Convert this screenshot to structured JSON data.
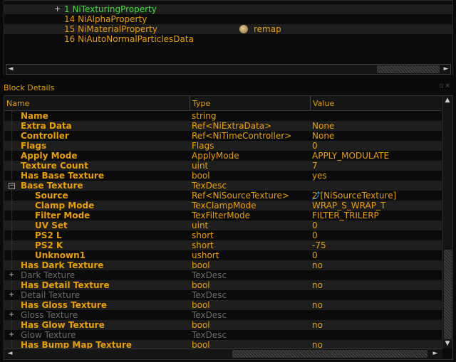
{
  "tree": {
    "rows": [
      {
        "label": "",
        "toggle": "",
        "extra": "",
        "sel": false
      },
      {
        "label": "1 NiTexturingProperty",
        "toggle": "+",
        "extra": "",
        "sel": true
      },
      {
        "label": "14 NiAlphaProperty",
        "toggle": "",
        "extra": "",
        "sel": false
      },
      {
        "label": "15 NiMaterialProperty",
        "toggle": "",
        "extra": "remap",
        "sel": false
      },
      {
        "label": "16 NiAutoNormalParticlesData",
        "toggle": "",
        "extra": "",
        "sel": false
      }
    ],
    "scroll_left": "◄",
    "scroll_right": "►"
  },
  "details": {
    "title": "Block Details",
    "columns": {
      "name": "Name",
      "type": "Type",
      "value": "Value"
    },
    "rows": [
      {
        "name": "Name",
        "type": "string",
        "value": "",
        "level": 0,
        "toggle": "",
        "dim": false
      },
      {
        "name": "Extra Data",
        "type": "Ref<NiExtraData>",
        "value": "None",
        "level": 0,
        "toggle": "",
        "dim": false
      },
      {
        "name": "Controller",
        "type": "Ref<NiTimeController>",
        "value": "None",
        "level": 0,
        "toggle": "",
        "dim": false
      },
      {
        "name": "Flags",
        "type": "Flags",
        "value": "0",
        "level": 0,
        "toggle": "",
        "dim": false
      },
      {
        "name": "Apply Mode",
        "type": "ApplyMode",
        "value": "APPLY_MODULATE",
        "level": 0,
        "toggle": "",
        "dim": false
      },
      {
        "name": "Texture Count",
        "type": "uint",
        "value": "7",
        "level": 0,
        "toggle": "",
        "dim": false
      },
      {
        "name": "Has Base Texture",
        "type": "bool",
        "value": "yes",
        "level": 0,
        "toggle": "",
        "dim": false
      },
      {
        "name": "Base Texture",
        "type": "TexDesc",
        "value": "",
        "level": 0,
        "toggle": "−",
        "dim": false
      },
      {
        "name": "Source",
        "type": "Ref<NiSourceTexture>",
        "value": "2 [NiSourceTexture]",
        "level": 1,
        "toggle": "",
        "dim": false,
        "link": true
      },
      {
        "name": "Clamp Mode",
        "type": "TexClampMode",
        "value": "WRAP_S_WRAP_T",
        "level": 1,
        "toggle": "",
        "dim": false
      },
      {
        "name": "Filter Mode",
        "type": "TexFilterMode",
        "value": "FILTER_TRILERP",
        "level": 1,
        "toggle": "",
        "dim": false
      },
      {
        "name": "UV Set",
        "type": "uint",
        "value": "0",
        "level": 1,
        "toggle": "",
        "dim": false
      },
      {
        "name": "PS2 L",
        "type": "short",
        "value": "0",
        "level": 1,
        "toggle": "",
        "dim": false
      },
      {
        "name": "PS2 K",
        "type": "short",
        "value": "-75",
        "level": 1,
        "toggle": "",
        "dim": false
      },
      {
        "name": "Unknown1",
        "type": "ushort",
        "value": "0",
        "level": 1,
        "toggle": "",
        "dim": false
      },
      {
        "name": "Has Dark Texture",
        "type": "bool",
        "value": "no",
        "level": 0,
        "toggle": "",
        "dim": false
      },
      {
        "name": "Dark Texture",
        "type": "TexDesc",
        "value": "",
        "level": 0,
        "toggle": "+",
        "dim": true
      },
      {
        "name": "Has Detail Texture",
        "type": "bool",
        "value": "no",
        "level": 0,
        "toggle": "",
        "dim": false
      },
      {
        "name": "Detail Texture",
        "type": "TexDesc",
        "value": "",
        "level": 0,
        "toggle": "+",
        "dim": true
      },
      {
        "name": "Has Gloss Texture",
        "type": "bool",
        "value": "no",
        "level": 0,
        "toggle": "",
        "dim": false
      },
      {
        "name": "Gloss Texture",
        "type": "TexDesc",
        "value": "",
        "level": 0,
        "toggle": "+",
        "dim": true
      },
      {
        "name": "Has Glow Texture",
        "type": "bool",
        "value": "no",
        "level": 0,
        "toggle": "",
        "dim": false
      },
      {
        "name": "Glow Texture",
        "type": "TexDesc",
        "value": "",
        "level": 0,
        "toggle": "+",
        "dim": true
      },
      {
        "name": "Has Bump Map Texture",
        "type": "bool",
        "value": "no",
        "level": 0,
        "toggle": "",
        "dim": false
      }
    ],
    "scroll_up": "▲",
    "scroll_down": "▼",
    "scroll_left": "◄",
    "scroll_right": "►"
  },
  "icons": {
    "material": "palette-icon",
    "link": "link-arrow-icon"
  },
  "colors": {
    "text": "#e8a000",
    "selected": "#3ce23c",
    "dim": "#6a6a6a",
    "bg": "#0b0b0b",
    "row_alt": "#1e1e1e"
  }
}
